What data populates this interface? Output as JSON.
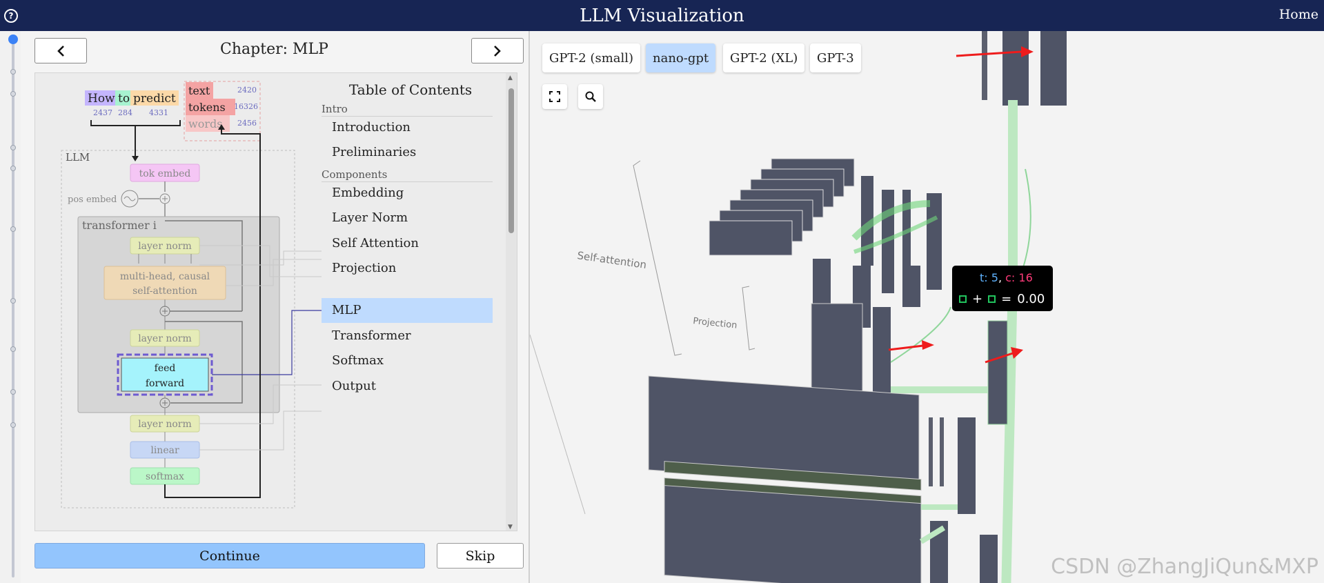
{
  "header": {
    "title": "LLM Visualization",
    "home": "Home",
    "help": "?"
  },
  "chapter": {
    "title": "Chapter: MLP",
    "prev": "‹",
    "next": "›"
  },
  "diagram": {
    "tokens": [
      {
        "word": "How",
        "id": "2437",
        "color": "#c4b5fd"
      },
      {
        "word": "to",
        "id": "284",
        "color": "#a7f3d0"
      },
      {
        "word": "predict",
        "id": "4331",
        "color": "#fcd9a8"
      }
    ],
    "outputs": [
      {
        "word": "text",
        "id": "2420"
      },
      {
        "word": "tokens",
        "id": "16326"
      },
      {
        "word": "words",
        "id": "2456"
      }
    ],
    "llm_label": "LLM",
    "tok_embed": "tok embed",
    "pos_embed": "pos embed",
    "transformer_label": "transformer i",
    "layer_norm": "layer norm",
    "attention_line1": "multi-head, causal",
    "attention_line2": "self-attention",
    "ff_line1": "feed",
    "ff_line2": "forward",
    "linear": "linear",
    "softmax": "softmax"
  },
  "toc": {
    "title": "Table of Contents",
    "sections": [
      {
        "name": "Intro",
        "items": [
          "Introduction",
          "Preliminaries"
        ]
      },
      {
        "name": "Components",
        "items": [
          "Embedding",
          "Layer Norm",
          "Self Attention",
          "Projection",
          "MLP",
          "Transformer",
          "Softmax",
          "Output"
        ]
      }
    ],
    "active": "MLP"
  },
  "footer": {
    "continue": "Continue",
    "skip": "Skip"
  },
  "models": [
    {
      "label": "GPT-2 (small)",
      "active": false
    },
    {
      "label": "nano-gpt",
      "active": true
    },
    {
      "label": "GPT-2 (XL)",
      "active": false
    },
    {
      "label": "GPT-3",
      "active": false
    }
  ],
  "viz": {
    "self_attention_label": "Self-attention",
    "projection_label": "Projection",
    "tooltip_t_label": "t:",
    "tooltip_t": "5",
    "tooltip_c_label": "c:",
    "tooltip_c": "16",
    "tooltip_plus": "+",
    "tooltip_eq": "=",
    "tooltip_value": "0.00"
  },
  "watermark": "CSDN @ZhangJiQun&MXP"
}
